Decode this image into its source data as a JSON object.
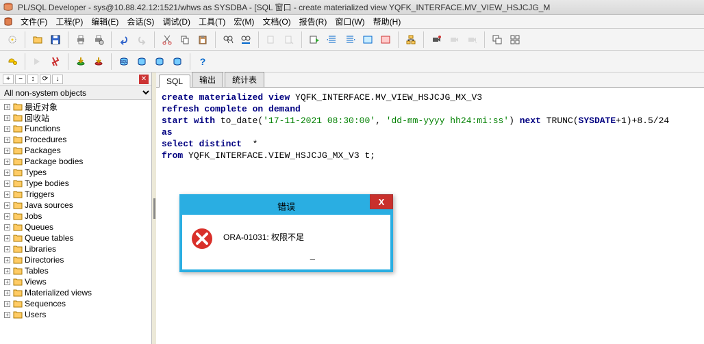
{
  "window": {
    "title": "PL/SQL Developer - sys@10.88.42.12:1521/whws as SYSDBA - [SQL 窗口 - create materialized view YQFK_INTERFACE.MV_VIEW_HSJCJG_M"
  },
  "menu": {
    "items": [
      "文件(F)",
      "工程(P)",
      "编辑(E)",
      "会话(S)",
      "调试(D)",
      "工具(T)",
      "宏(M)",
      "文档(O)",
      "报告(R)",
      "窗口(W)",
      "帮助(H)"
    ]
  },
  "toolbar1_icons": [
    "new",
    "open",
    "save",
    "sep",
    "print",
    "printsetup",
    "sep",
    "undo",
    "redo",
    "sep",
    "cut",
    "copy",
    "paste",
    "sep",
    "find",
    "findnext",
    "sep",
    "bookmark",
    "bookmark2",
    "sep",
    "execute",
    "step",
    "stepover",
    "stop",
    "sep",
    "commit",
    "rollback",
    "sep",
    "rec",
    "recstop",
    "recplay",
    "sep",
    "win1",
    "win2"
  ],
  "toolbar2_icons": [
    "key",
    "sep",
    "flash1",
    "flash2",
    "sep",
    "lamp1",
    "lamp2",
    "sep",
    "db1",
    "db2",
    "db3",
    "db4",
    "sep",
    "help"
  ],
  "browser": {
    "buttons": [
      "+",
      "−",
      "↕",
      "⟳",
      "↓"
    ],
    "filter_selected": "All non-system objects",
    "nodes": [
      "最近对象",
      "回收站",
      "Functions",
      "Procedures",
      "Packages",
      "Package bodies",
      "Types",
      "Type bodies",
      "Triggers",
      "Java sources",
      "Jobs",
      "Queues",
      "Queue tables",
      "Libraries",
      "Directories",
      "Tables",
      "Views",
      "Materialized views",
      "Sequences",
      "Users"
    ]
  },
  "tabs": {
    "items": [
      "SQL",
      "输出",
      "统计表"
    ],
    "active": 0
  },
  "sql": {
    "l1_a": "create materialized view",
    "l1_b": " YQFK_INTERFACE.MV_VIEW_HSJCJG_MX_V3",
    "l2": "refresh complete on demand",
    "l3_a": "start with",
    "l3_b": " to_date(",
    "l3_c": "'17-11-2021 08:30:00'",
    "l3_d": ", ",
    "l3_e": "'dd-mm-yyyy hh24:mi:ss'",
    "l3_f": ") ",
    "l3_g": "next",
    "l3_h": " TRUNC(",
    "l3_i": "SYSDATE",
    "l3_j": "+1)+8.5/24",
    "l4": "as",
    "l5_a": "select distinct",
    "l5_b": "  *",
    "l6_a": "from",
    "l6_b": " YQFK_INTERFACE.VIEW_HSJCJG_MX_V3 t;"
  },
  "dialog": {
    "title": "错误",
    "message": "ORA-01031: 权限不足",
    "close": "X"
  }
}
